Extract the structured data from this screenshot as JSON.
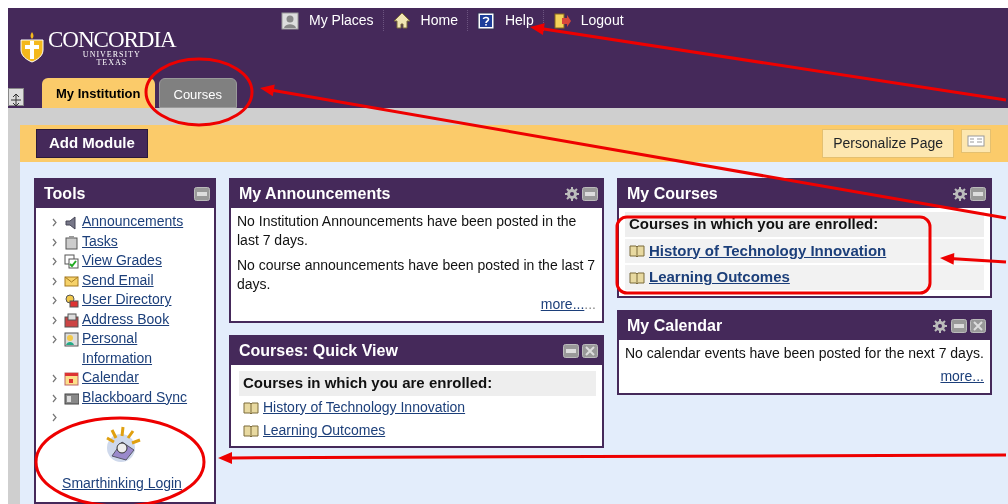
{
  "top_nav": [
    {
      "label": "My Places"
    },
    {
      "label": "Home"
    },
    {
      "label": "Help"
    },
    {
      "label": "Logout"
    }
  ],
  "logo": {
    "name": "CONCORDIA",
    "line_2": "UNIVERSITY",
    "line_3": "TEXAS"
  },
  "tabs": [
    {
      "label": "My Institution",
      "selected": true
    },
    {
      "label": "Courses",
      "selected": false
    }
  ],
  "toolbar": {
    "add_module": "Add Module",
    "personalize": "Personalize Page"
  },
  "tools": {
    "title": "Tools",
    "settings": false,
    "closable": false,
    "items": [
      {
        "label": "Announcements"
      },
      {
        "label": "Tasks"
      },
      {
        "label": "View Grades"
      },
      {
        "label": "Send Email"
      },
      {
        "label": "User Directory"
      },
      {
        "label": "Address Book"
      },
      {
        "label": "Personal Information"
      },
      {
        "label": "Calendar"
      },
      {
        "label": "Blackboard Sync"
      }
    ],
    "smarthinking": "Smarthinking Login"
  },
  "announcements": {
    "title": "My Announcements",
    "settings": true,
    "closable": false,
    "paragraphs": [
      "No Institution Announcements have been posted in the last 7 days.",
      "No course announcements have been posted in the last 7 days."
    ],
    "more": "more...",
    "more_tail": "..."
  },
  "quick_view": {
    "title": "Courses: Quick View",
    "settings": false,
    "closable": true,
    "heading": "Courses in which you are enrolled:",
    "courses": [
      "History of Technology Innovation",
      "Learning Outcomes"
    ]
  },
  "my_courses": {
    "title": "My Courses",
    "settings": true,
    "closable": false,
    "heading": "Courses in which you are enrolled:",
    "courses": [
      "History of Technology Innovation",
      "Learning Outcomes"
    ]
  },
  "calendar": {
    "title": "My Calendar",
    "settings": true,
    "closable": true,
    "text": "No calendar events have been posted for the next 7 days.",
    "more": "more..."
  }
}
